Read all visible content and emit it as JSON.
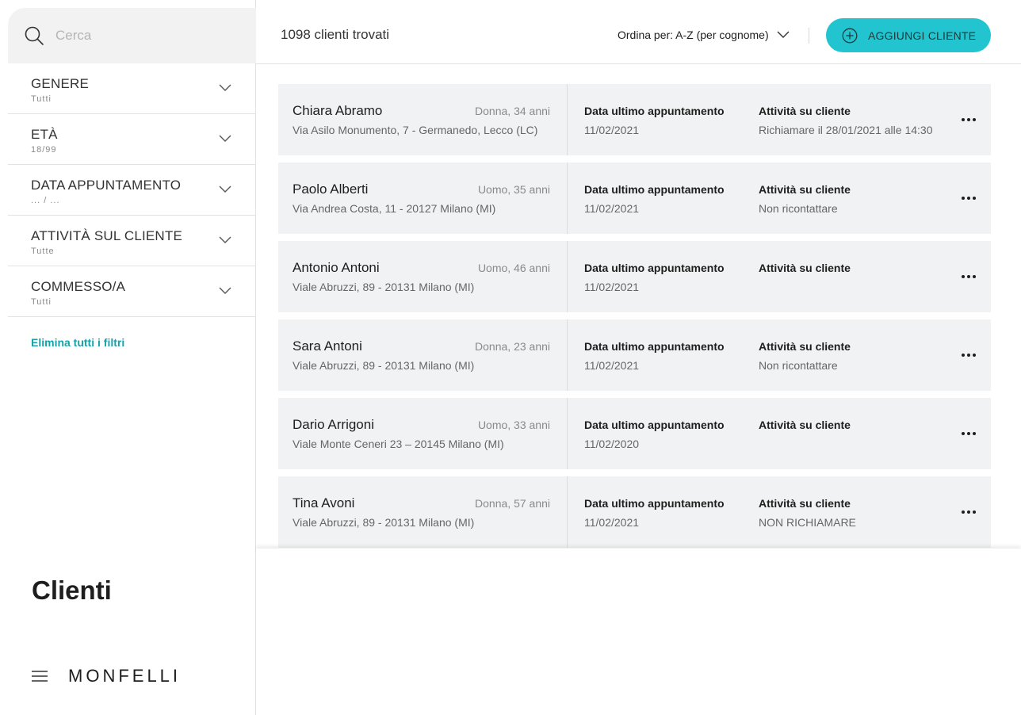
{
  "colors": {
    "accent": "#22c5cf",
    "link": "#15a3a9",
    "card_bg": "#f1f2f3"
  },
  "sidebar": {
    "search": {
      "placeholder": "Cerca",
      "icon": "search-icon"
    },
    "filters": [
      {
        "label": "GENERE",
        "value": "Tutti"
      },
      {
        "label": "ETÀ",
        "value": "18/99"
      },
      {
        "label": "DATA APPUNTAMENTO",
        "value": "... / ..."
      },
      {
        "label": "ATTIVITÀ SUL CLIENTE",
        "value": "Tutte"
      },
      {
        "label": "COMMESSO/A",
        "value": "Tutti"
      }
    ],
    "clear_filters": "Elimina tutti i filtri",
    "page_title": "Clienti",
    "brand": "MONFELLI"
  },
  "topbar": {
    "results_count": "1098 clienti trovati",
    "sort_label": "Ordina per: A-Z (per cognome)",
    "add_button": "AGGIUNGI CLIENTE"
  },
  "clients": [
    {
      "name": "Chiara Abramo",
      "info": "Donna, 34 anni",
      "address": "Via Asilo Monumento, 7 - Germanedo, Lecco (LC)",
      "date_label": "Data ultimo appuntamento",
      "date": "11/02/2021",
      "activity_label": "Attività su cliente",
      "activity": "Richiamare il 28/01/2021 alle 14:30"
    },
    {
      "name": "Paolo Alberti",
      "info": "Uomo, 35 anni",
      "address": "Via Andrea Costa, 11 - 20127 Milano (MI)",
      "date_label": "Data ultimo appuntamento",
      "date": "11/02/2021",
      "activity_label": "Attività su cliente",
      "activity": "Non ricontattare"
    },
    {
      "name": "Antonio Antoni",
      "info": "Uomo, 46 anni",
      "address": "Viale Abruzzi, 89 - 20131 Milano (MI)",
      "date_label": "Data ultimo appuntamento",
      "date": "11/02/2021",
      "activity_label": "Attività su cliente",
      "activity": ""
    },
    {
      "name": "Sara Antoni",
      "info": "Donna, 23 anni",
      "address": "Viale Abruzzi, 89 - 20131 Milano (MI)",
      "date_label": "Data ultimo appuntamento",
      "date": "11/02/2021",
      "activity_label": "Attività su cliente",
      "activity": "Non ricontattare"
    },
    {
      "name": "Dario Arrigoni",
      "info": "Uomo, 33 anni",
      "address": "Viale Monte Ceneri 23 – 20145 Milano (MI)",
      "date_label": "Data ultimo appuntamento",
      "date": "11/02/2020",
      "activity_label": "Attività su cliente",
      "activity": ""
    },
    {
      "name": "Tina Avoni",
      "info": "Donna, 57 anni",
      "address": "Viale Abruzzi, 89 - 20131 Milano (MI)",
      "date_label": "Data ultimo appuntamento",
      "date": "11/02/2021",
      "activity_label": "Attività su cliente",
      "activity": "NON RICHIAMARE"
    }
  ]
}
